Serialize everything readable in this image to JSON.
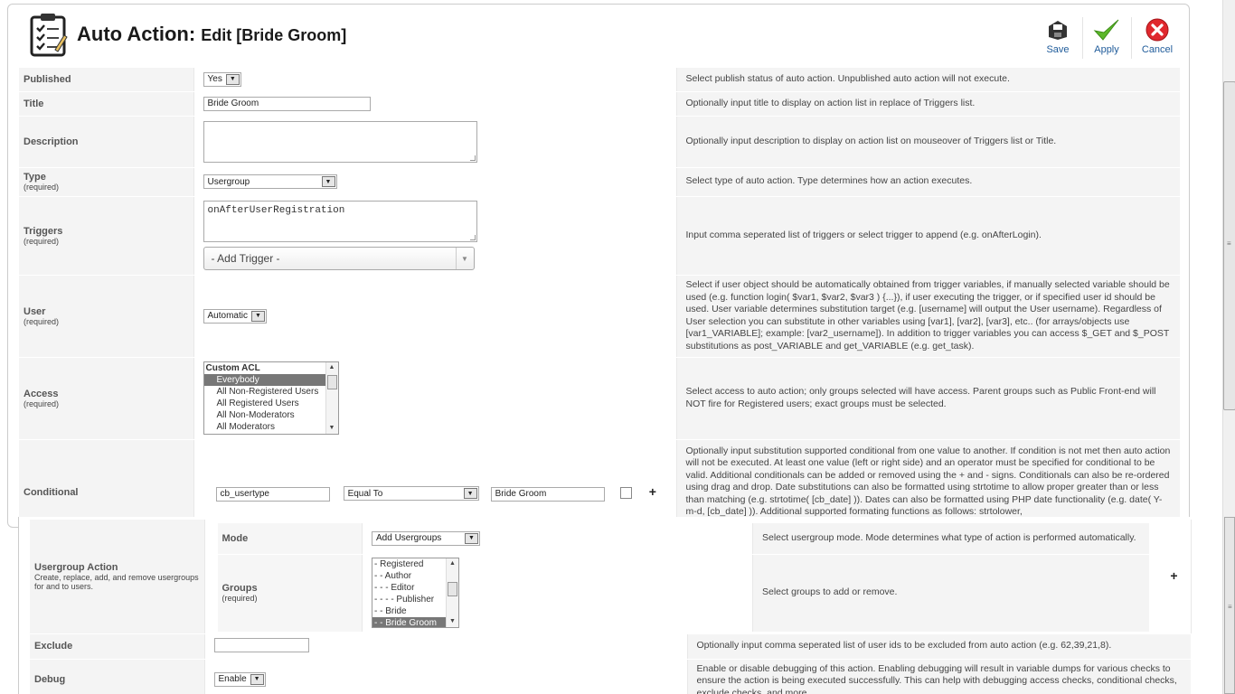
{
  "header": {
    "title": "Auto Action:",
    "subtitle": "Edit [Bride Groom]",
    "save": "Save",
    "apply": "Apply",
    "cancel": "Cancel"
  },
  "fields": {
    "published": {
      "label": "Published",
      "value": "Yes",
      "desc": "Select publish status of auto action. Unpublished auto action will not execute."
    },
    "title": {
      "label": "Title",
      "value": "Bride Groom",
      "desc": "Optionally input title to display on action list in replace of Triggers list."
    },
    "description": {
      "label": "Description",
      "value": "",
      "desc": "Optionally input description to display on action list on mouseover of Triggers list or Title."
    },
    "type": {
      "label": "Type",
      "required": "(required)",
      "value": "Usergroup",
      "desc": "Select type of auto action. Type determines how an action executes."
    },
    "triggers": {
      "label": "Triggers",
      "required": "(required)",
      "value": "onAfterUserRegistration",
      "add_trigger": "- Add Trigger -",
      "desc": "Input comma seperated list of triggers or select trigger to append (e.g. onAfterLogin)."
    },
    "user": {
      "label": "User",
      "required": "(required)",
      "value": "Automatic",
      "desc": "Select if user object should be automatically obtained from trigger variables, if manually selected variable should be used (e.g. function login( $var1, $var2, $var3 ) {...}), if user executing the trigger, or if specified user id should be used. User variable determines substitution target (e.g. [username] will output the User username). Regardless of User selection you can substitute in other variables using [var1], [var2], [var3], etc.. (for arrays/objects use [var1_VARIABLE]; example: [var2_username]). In addition to trigger variables you can access $_GET and $_POST substitutions as post_VARIABLE and get_VARIABLE (e.g. get_task)."
    },
    "access": {
      "label": "Access",
      "required": "(required)",
      "group": "Custom ACL",
      "options": [
        "Everybody",
        "All Non-Registered Users",
        "All Registered Users",
        "All Non-Moderators",
        "All Moderators"
      ],
      "selected": "Everybody",
      "desc": "Select access to auto action; only groups selected will have access. Parent groups such as Public Front-end will NOT fire for Registered users; exact groups must be selected."
    },
    "conditional": {
      "label": "Conditional",
      "field": "cb_usertype",
      "operator": "Equal To",
      "value": "Bride Groom",
      "plus": "+",
      "desc": "Optionally input substitution supported conditional from one value to another. If condition is not met then auto action will not be executed. At least one value (left or right side) and an operator must be specified for conditional to be valid. Additional conditionals can be added or removed using the + and - signs. Conditionals can also be re-ordered using drag and drop. Date substitutions can also be formatted using strtotime to allow proper greater than or less than matching (e.g. strtotime( [cb_date] )). Dates can also be formatted using PHP date functionality (e.g. date( Y-m-d, [cb_date] )). Additional supported formating functions as follows: strtolower,"
    },
    "usergroup_action": {
      "label": "Usergroup Action",
      "help": "Create, replace, add, and remove usergroups for and to users.",
      "plus": "+",
      "mode": {
        "label": "Mode",
        "value": "Add Usergroups",
        "desc": "Select usergroup mode. Mode determines what type of action is performed automatically."
      },
      "groups": {
        "label": "Groups",
        "required": "(required)",
        "options": [
          "- Registered",
          "- - Author",
          "- - - Editor",
          "- - - - Publisher",
          "- - Bride",
          "- - Bride Groom"
        ],
        "selected": "- - Bride Groom",
        "desc": "Select groups to add or remove."
      }
    },
    "exclude": {
      "label": "Exclude",
      "value": "",
      "desc": "Optionally input comma seperated list of user ids to be excluded from auto action (e.g. 62,39,21,8)."
    },
    "debug": {
      "label": "Debug",
      "value": "Enable",
      "desc": "Enable or disable debugging of this action. Enabling debugging will result in variable dumps for various checks to ensure the action is being executed successfully. This can help with debugging access checks, conditional checks, exclude checks, and more."
    }
  },
  "colors": {
    "accent": "#1f5b9a",
    "apply": "#4caf1f",
    "cancel": "#d9262b",
    "label_bg": "#f4f4f4"
  }
}
